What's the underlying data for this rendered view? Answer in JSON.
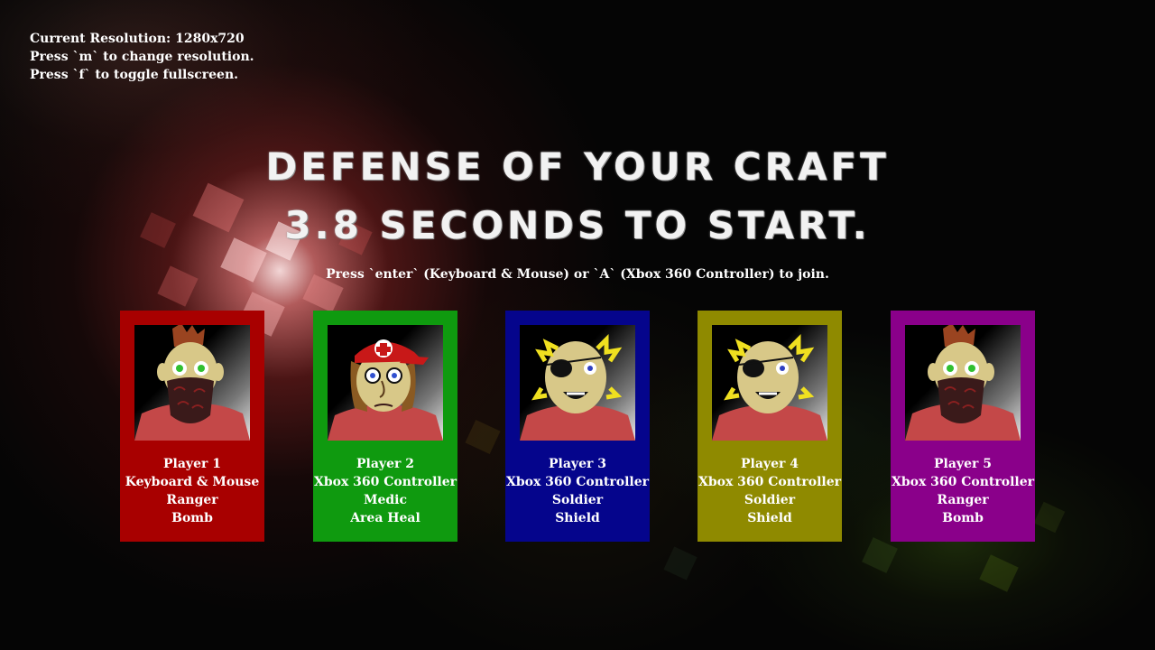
{
  "info": {
    "resolution": "Current Resolution: 1280x720",
    "resolution_hint": "Press `m` to change resolution.",
    "fullscreen_hint": "Press `f` to toggle fullscreen."
  },
  "title": "DEFENSE OF YOUR CRAFT",
  "countdown": "3.8 SECONDS TO START.",
  "join_hint": "Press `enter` (Keyboard & Mouse) or `A` (Xbox 360 Controller) to join.",
  "players": [
    {
      "name": "Player 1",
      "input": "Keyboard & Mouse",
      "class": "Ranger",
      "ability": "Bomb",
      "color": "#a80000",
      "portrait": "ranger-portrait"
    },
    {
      "name": "Player 2",
      "input": "Xbox 360 Controller",
      "class": "Medic",
      "ability": "Area Heal",
      "color": "#0f9a0f",
      "portrait": "medic-portrait"
    },
    {
      "name": "Player 3",
      "input": "Xbox 360 Controller",
      "class": "Soldier",
      "ability": "Shield",
      "color": "#05058c",
      "portrait": "soldier-portrait"
    },
    {
      "name": "Player 4",
      "input": "Xbox 360 Controller",
      "class": "Soldier",
      "ability": "Shield",
      "color": "#8f8a00",
      "portrait": "soldier-portrait"
    },
    {
      "name": "Player 5",
      "input": "Xbox 360 Controller",
      "class": "Ranger",
      "ability": "Bomb",
      "color": "#8a008a",
      "portrait": "ranger-portrait"
    }
  ]
}
